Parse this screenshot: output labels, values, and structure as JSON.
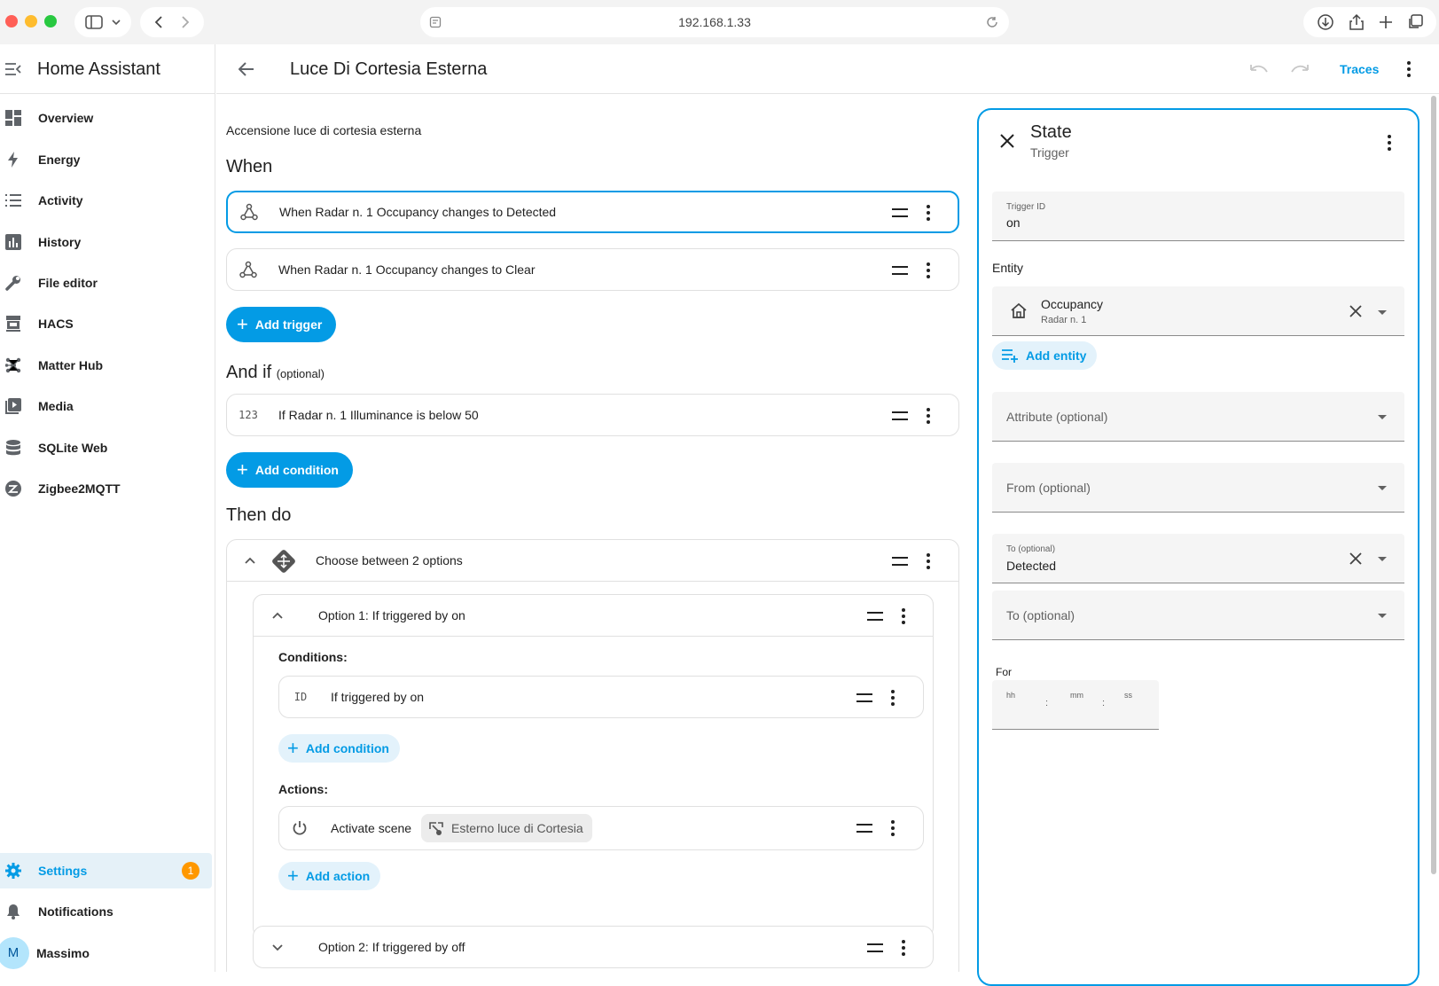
{
  "browser": {
    "url": "192.168.1.33"
  },
  "sidebar": {
    "app_title": "Home Assistant",
    "items": [
      {
        "label": "Overview",
        "icon": "dashboard-icon"
      },
      {
        "label": "Energy",
        "icon": "lightning-icon"
      },
      {
        "label": "Activity",
        "icon": "list-icon"
      },
      {
        "label": "History",
        "icon": "chart-bar-icon"
      },
      {
        "label": "File editor",
        "icon": "wrench-icon"
      },
      {
        "label": "HACS",
        "icon": "store-icon"
      },
      {
        "label": "Matter Hub",
        "icon": "hub-icon"
      },
      {
        "label": "Media",
        "icon": "media-icon"
      },
      {
        "label": "SQLite Web",
        "icon": "database-icon"
      },
      {
        "label": "Zigbee2MQTT",
        "icon": "zigbee-icon"
      }
    ],
    "settings": {
      "label": "Settings",
      "badge": "1"
    },
    "notifications": {
      "label": "Notifications"
    },
    "user": {
      "initial": "M",
      "name": "Massimo"
    }
  },
  "header": {
    "title": "Luce Di Cortesia Esterna",
    "traces_label": "Traces"
  },
  "automation": {
    "description": "Accensione luce di cortesia esterna",
    "when_title": "When",
    "triggers": [
      "When Radar n. 1 Occupancy changes to Detected",
      "When Radar n. 1 Occupancy changes to Clear"
    ],
    "add_trigger": "Add trigger",
    "andif_title": "And if",
    "andif_optional": "(optional)",
    "conditions": [
      {
        "icon_text": "123",
        "label": "If Radar n. 1 Illuminance is below 50"
      }
    ],
    "add_condition": "Add condition",
    "then_title": "Then do",
    "choose": {
      "label": "Choose between 2 options",
      "option1": {
        "label": "Option 1: If triggered by on",
        "conditions_label": "Conditions:",
        "condition": {
          "icon_text": "ID",
          "label": "If triggered by on"
        },
        "add_condition": "Add condition",
        "actions_label": "Actions:",
        "action": {
          "label": "Activate scene",
          "chip": "Esterno luce di Cortesia"
        },
        "add_action": "Add action"
      },
      "option2": {
        "label": "Option 2: If triggered by off"
      }
    }
  },
  "panel": {
    "title": "State",
    "subtitle": "Trigger",
    "trigger_id": {
      "label": "Trigger ID",
      "value": "on"
    },
    "entity_label": "Entity",
    "entity": {
      "name": "Occupancy",
      "device": "Radar n. 1"
    },
    "add_entity": "Add entity",
    "attribute_placeholder": "Attribute (optional)",
    "from_placeholder": "From (optional)",
    "to_filled": {
      "label": "To (optional)",
      "value": "Detected"
    },
    "to_placeholder": "To (optional)",
    "for_label": "For",
    "for": {
      "hh": "hh",
      "mm": "mm",
      "ss": "ss",
      "sep": ":"
    }
  }
}
